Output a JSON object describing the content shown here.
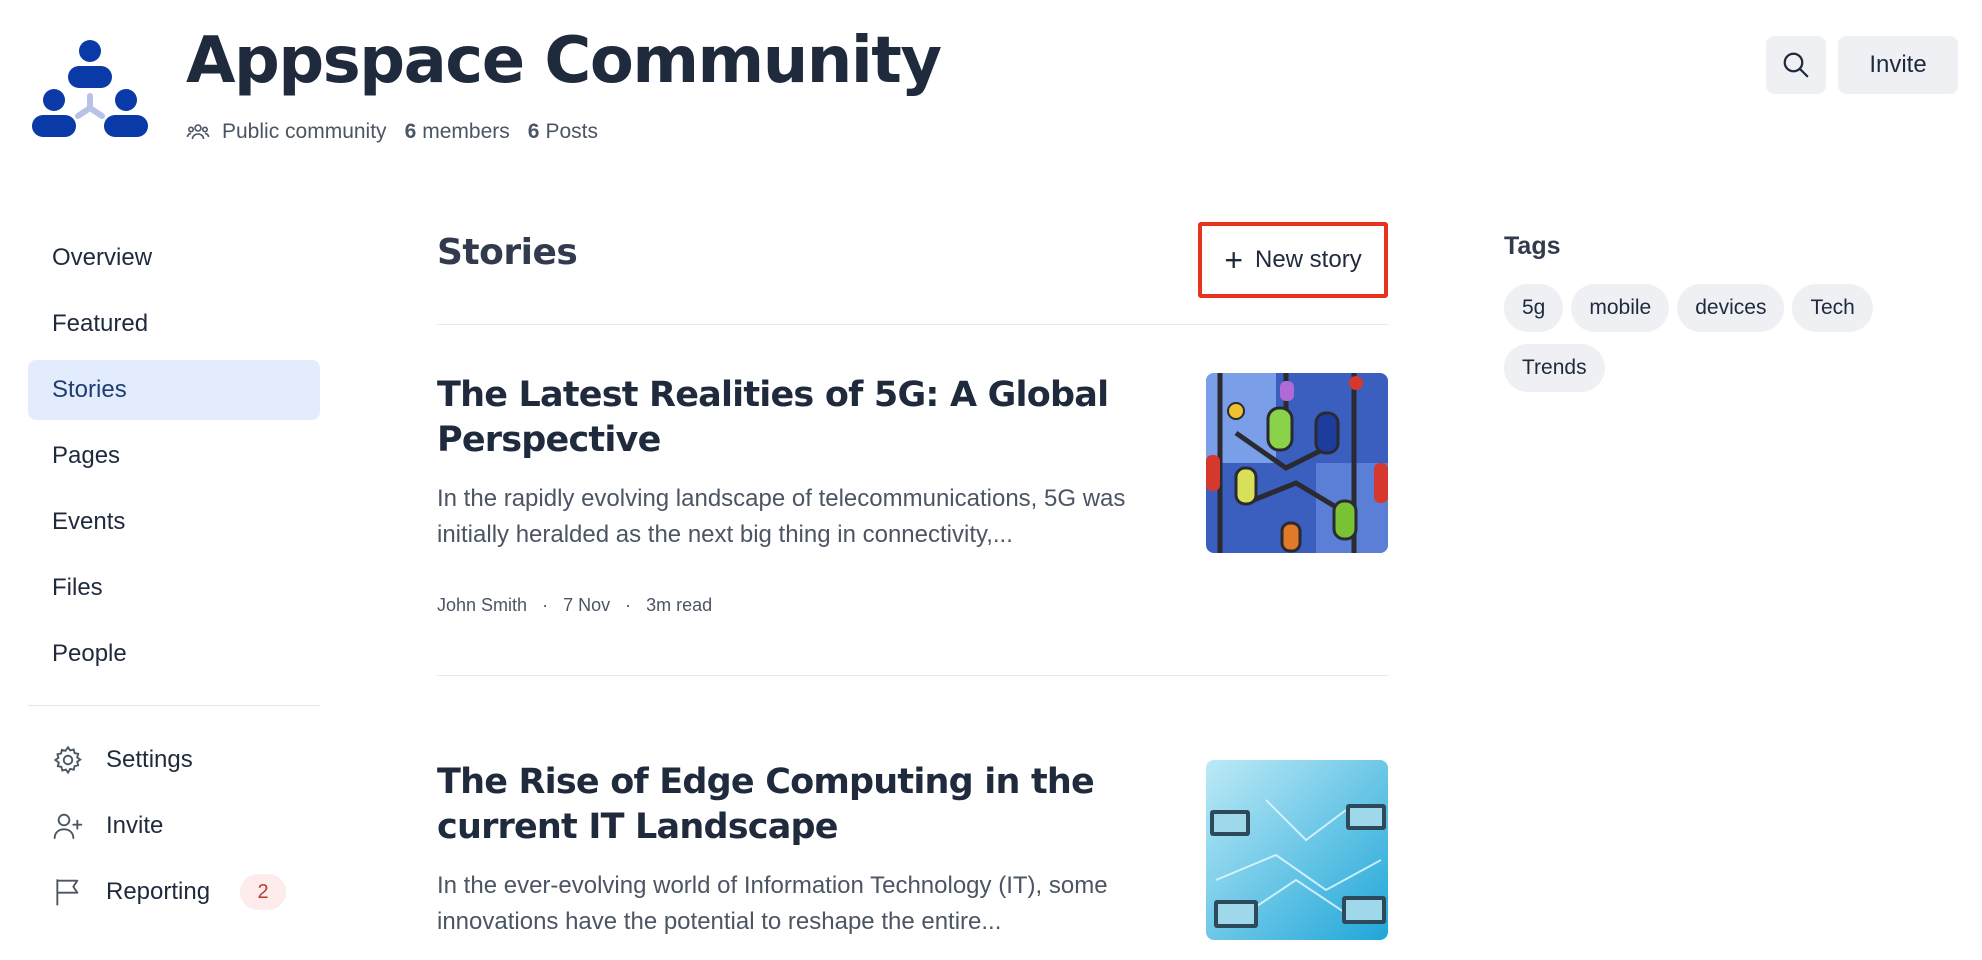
{
  "header": {
    "title": "Appspace Community",
    "visibility": "Public community",
    "members_count": "6",
    "members_label": "members",
    "posts_count": "6",
    "posts_label": "Posts",
    "invite_label": "Invite"
  },
  "sidebar": {
    "items": [
      {
        "label": "Overview",
        "active": false
      },
      {
        "label": "Featured",
        "active": false
      },
      {
        "label": "Stories",
        "active": true
      },
      {
        "label": "Pages",
        "active": false
      },
      {
        "label": "Events",
        "active": false
      },
      {
        "label": "Files",
        "active": false
      },
      {
        "label": "People",
        "active": false
      }
    ],
    "utility": {
      "settings": "Settings",
      "invite": "Invite",
      "reporting": "Reporting",
      "reporting_badge": "2"
    }
  },
  "main": {
    "heading": "Stories",
    "new_story_label": "New story",
    "stories": [
      {
        "title": "The Latest Realities of 5G: A Global Perspective",
        "excerpt": "In the rapidly evolving landscape of telecommunications, 5G was initially heralded as the next big thing in connectivity,...",
        "author": "John Smith",
        "date": "7 Nov",
        "read_time": "3m read"
      },
      {
        "title": "The Rise of Edge Computing in the current IT Landscape",
        "excerpt": "In the ever-evolving world of Information Technology (IT), some innovations have the potential to reshape the entire..."
      }
    ]
  },
  "tags": {
    "title": "Tags",
    "items": [
      "5g",
      "mobile",
      "devices",
      "Tech",
      "Trends"
    ]
  },
  "colors": {
    "brand_blue": "#0a3aa8",
    "active_nav_bg": "#e3ecfd",
    "highlight_border": "#e6321e",
    "badge_text": "#c0392b"
  },
  "icons": [
    "search-icon",
    "people-icon",
    "gear-icon",
    "user-plus-icon",
    "flag-icon",
    "plus-icon"
  ]
}
